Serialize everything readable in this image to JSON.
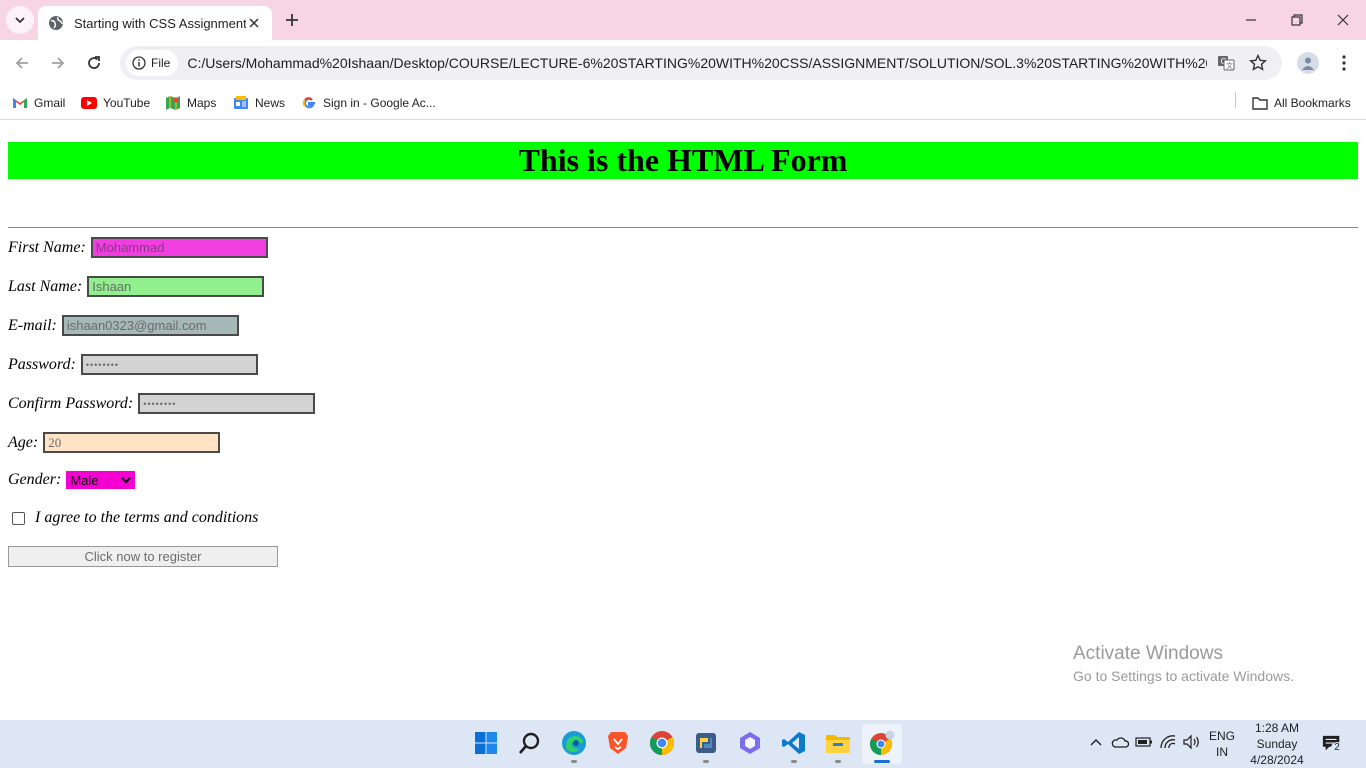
{
  "browser": {
    "tab_title": "Starting with CSS Assignment",
    "file_chip": "File",
    "url": "C:/Users/Mohammad%20Ishaan/Desktop/COURSE/LECTURE-6%20STARTING%20WITH%20CSS/ASSIGNMENT/SOLUTION/SOL.3%20STARTING%20WITH%20CSS%20...",
    "bookmarks": [
      "Gmail",
      "YouTube",
      "Maps",
      "News",
      "Sign in - Google Ac..."
    ],
    "all_bookmarks": "All Bookmarks"
  },
  "page": {
    "title": "This is the HTML Form",
    "fields": {
      "first_name": {
        "label": "First Name:",
        "value": "Mohammad"
      },
      "last_name": {
        "label": "Last Name:",
        "value": "Ishaan"
      },
      "email": {
        "label": "E-mail:",
        "value": "ishaan0323@gmail.com"
      },
      "password": {
        "label": "Password:",
        "value": "••••••••"
      },
      "confirm_password": {
        "label": "Confirm Password:",
        "value": "••••••••"
      },
      "age": {
        "label": "Age:",
        "value": "20"
      },
      "gender": {
        "label": "Gender:",
        "value": "Male"
      },
      "terms": {
        "label": "I agree to the terms and conditions",
        "checked": false
      }
    },
    "submit_label": "Click now to register",
    "colors": {
      "title_bg": "#00ff00",
      "first_name_bg": "#f03ee0",
      "last_name_bg": "#92ef8e",
      "email_bg": "#a7b8b8",
      "password_bg": "#d3d3d3",
      "age_bg": "#ffe3c4",
      "gender_bg": "#f500d3"
    }
  },
  "watermark": {
    "line1": "Activate Windows",
    "line2": "Go to Settings to activate Windows."
  },
  "taskbar": {
    "lang_top": "ENG",
    "lang_bottom": "IN",
    "time": "1:28 AM",
    "day": "Sunday",
    "date": "4/28/2024",
    "notifications": "2"
  }
}
